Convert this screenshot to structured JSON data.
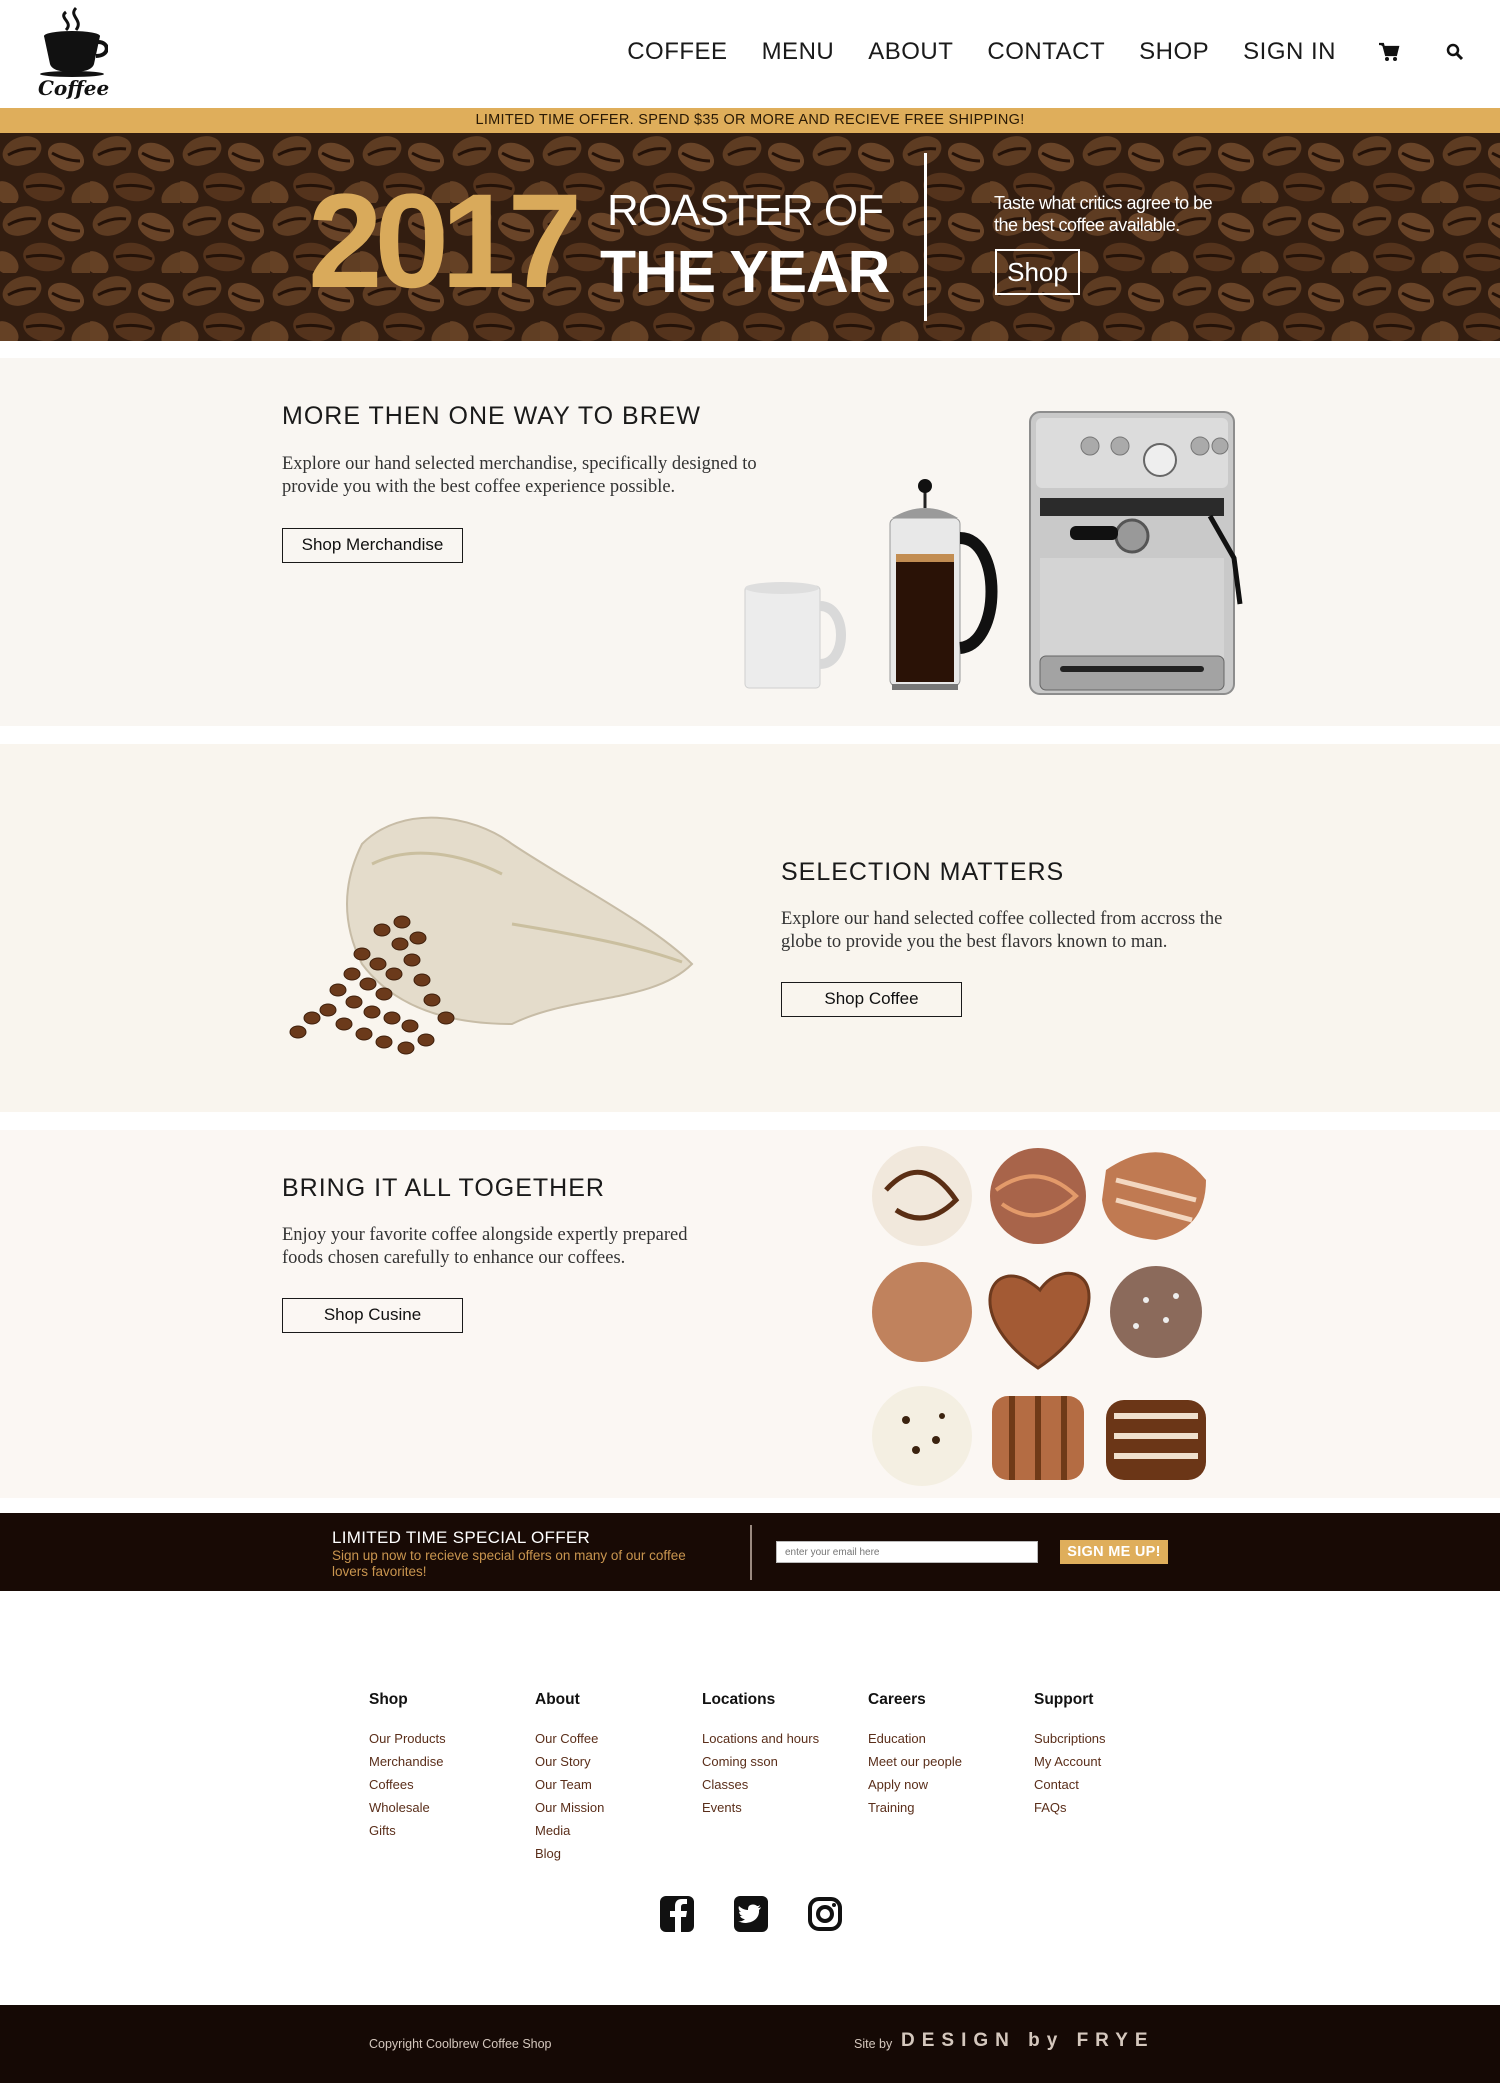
{
  "header": {
    "logo_text": "Coffee",
    "nav": [
      "COFFEE",
      "MENU",
      "ABOUT",
      "CONTACT",
      "SHOP",
      "SIGN IN"
    ],
    "icons": [
      "cart-icon",
      "search-icon"
    ]
  },
  "promo_bar": {
    "text": "LIMITED TIME OFFER. SPEND $35 OR MORE AND RECIEVE FREE SHIPPING!"
  },
  "hero": {
    "year": "2017",
    "line1": "ROASTER OF",
    "line2": "THE YEAR",
    "tagline": "Taste what critics agree to be the best coffee available.",
    "button_label": "Shop"
  },
  "sections": {
    "brew": {
      "title": "MORE THEN ONE WAY TO BREW",
      "body": "Explore our hand selected merchandise, specifically designed to provide you with the best coffee experience possible.",
      "button_label": "Shop Merchandise"
    },
    "selection": {
      "title": "SELECTION MATTERS",
      "body": "Explore our hand selected coffee collected from accross the globe to provide you the best flavors known to man.",
      "button_label": "Shop Coffee"
    },
    "together": {
      "title": "BRING IT ALL TOGETHER",
      "body": "Enjoy your favorite coffee alongside expertly prepared foods chosen carefully to enhance our coffees.",
      "button_label": "Shop Cusine"
    }
  },
  "signup": {
    "title": "LIMITED TIME SPECIAL OFFER",
    "text": "Sign up now to recieve special offers on many of our coffee lovers favorites!",
    "placeholder": "enter your email here",
    "button_label": "SIGN ME UP!"
  },
  "footer": {
    "columns": [
      {
        "heading": "Shop",
        "links": [
          "Our Products",
          "Merchandise",
          "Coffees",
          "Wholesale",
          "Gifts"
        ]
      },
      {
        "heading": "About",
        "links": [
          "Our Coffee",
          "Our Story",
          "Our Team",
          "Our Mission",
          "Media",
          "Blog"
        ]
      },
      {
        "heading": "Locations",
        "links": [
          "Locations and hours",
          "Coming sson",
          "Classes",
          "Events"
        ]
      },
      {
        "heading": "Careers",
        "links": [
          "Education",
          "Meet our people",
          "Apply now",
          "Training"
        ]
      },
      {
        "heading": "Support",
        "links": [
          "Subcriptions",
          "My Account",
          "Contact",
          "FAQs"
        ]
      }
    ],
    "social": [
      "facebook-icon",
      "twitter-icon",
      "instagram-icon"
    ]
  },
  "bottom": {
    "copyright": "Copyright Coolbrew Coffee Shop",
    "site_by": "Site by",
    "brand": "DESIGN by FRYE"
  },
  "colors": {
    "accent_gold": "#dfae5b",
    "dark_brown": "#180a05",
    "link_brown": "#5a2e1a"
  }
}
